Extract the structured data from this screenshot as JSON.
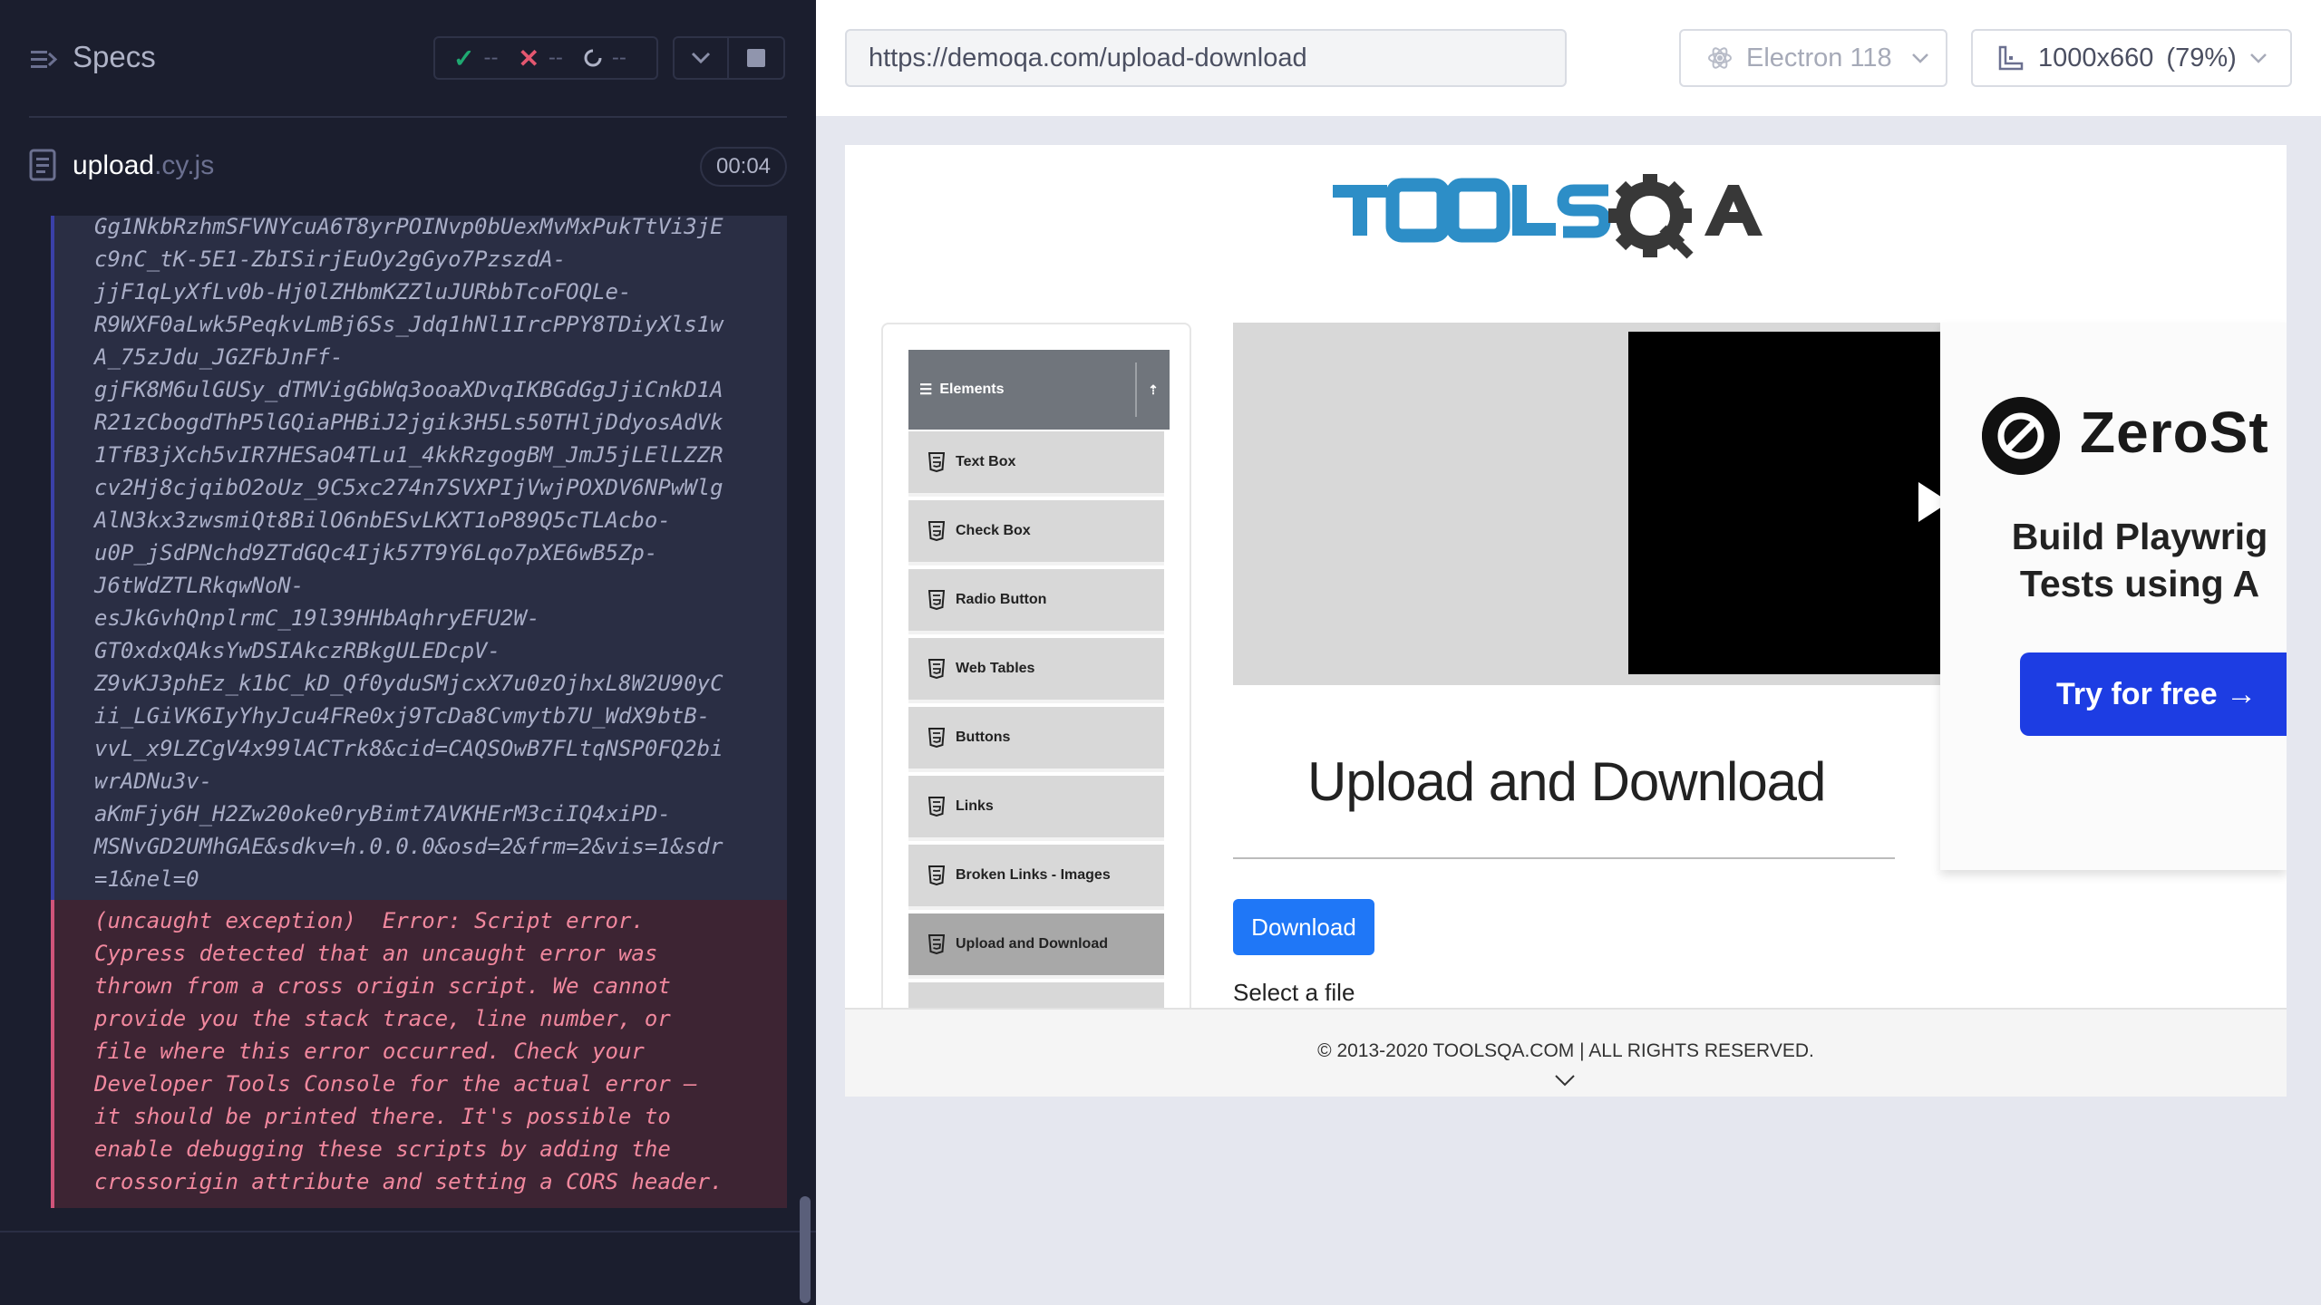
{
  "runner": {
    "title": "Specs",
    "stats": {
      "passed": "--",
      "failed": "--",
      "pending": "--"
    },
    "spec_file": {
      "name": "upload",
      "ext": ".cy.js",
      "duration": "00:04"
    },
    "log_url_text": "Gg1NkbRzhmSFVNYcuA6T8yrPOINvp0bUexMvMxPukTtVi3jE\nc9nC_tK-5E1-ZbISirjEuOy2gGyo7PzszdA-\njjF1qLyXfLv0b-Hj0lZHbmKZZluJURbbTcoFOQLe-\nR9WXF0aLwk5PeqkvLmBj6Ss_Jdq1hNl1IrcPPY8TDiyXls1w\nA_75zJdu_JGZFbJnFf-\ngjFK8M6ulGUSy_dTMVigGbWq3ooaXDvqIKBGdGgJjiCnkD1A\nR21zCbogdThP5lGQiaPHBiJ2jgik3H5Ls50THljDdyosAdVk\n1TfB3jXch5vIR7HESaO4TLu1_4kkRzgogBM_JmJ5jLElLZZR\ncv2Hj8cjqibO2oUz_9C5xc274n7SVXPIjVwjPOXDV6NPwWlg\nAlN3kx3zwsmiQt8BilO6nbESvLKXT1oP89Q5cTLAcbo-\nu0P_jSdPNchd9ZTdGQc4Ijk57T9Y6Lqo7pXE6wB5Zp-\nJ6tWdZTLRkqwNoN-\nesJkGvhQnplrmC_19l39HHbAqhryEFU2W-\nGT0xdxQAksYwDSIAkczRBkgULEDcpV-\nZ9vKJ3phEz_k1bC_kD_Qf0yduSMjcxX7u0zOjhxL8W2U90yC\nii_LGiVK6IyYhyJcu4FRe0xj9TcDa8Cvmytb7U_WdX9btB-\nvvL_x9LZCgV4x99lACTrk8&cid=CAQSOwB7FLtqNSP0FQ2bi\nwrADNu3v-\naKmFjy6H_H2Zw20oke0ryBimt7AVKHErM3ciIQ4xiPD-\nMSNvGD2UMhGAE&sdkv=h.0.0.0&osd=2&frm=2&vis=1&sdr\n=1&nel=0",
    "error_text": "(uncaught exception)  Error: Script error.\nCypress detected that an uncaught error was\nthrown from a cross origin script. We cannot\nprovide you the stack trace, line number, or\nfile where this error occurred. Check your\nDeveloper Tools Console for the actual error –\nit should be printed there. It's possible to\nenable debugging these scripts by adding the\ncrossorigin attribute and setting a CORS header."
  },
  "aut": {
    "url": "https://demoqa.com/upload-download",
    "browser": "Electron 118",
    "viewport": "1000x660",
    "viewport_scale": "(79%)"
  },
  "site": {
    "logo_alt": "TOOLSQA",
    "sidebar": {
      "group_label": "Elements",
      "items": [
        {
          "label": "Text Box"
        },
        {
          "label": "Check Box"
        },
        {
          "label": "Radio Button"
        },
        {
          "label": "Web Tables"
        },
        {
          "label": "Buttons"
        },
        {
          "label": "Links"
        },
        {
          "label": "Broken Links - Images"
        },
        {
          "label": "Upload and Download"
        }
      ]
    },
    "ad": {
      "brand": "ZeroSt",
      "headline": "Build Playwrig\nTests using A",
      "cta": "Try for free →"
    },
    "heading": "Upload and Download",
    "download_label": "Download",
    "select_label": "Select a file",
    "footer": "© 2013-2020 TOOLSQA.COM | ALL RIGHTS RESERVED."
  },
  "colors": {
    "runner_bg": "#1b1e2e",
    "pass": "#1fa971",
    "fail": "#e45770",
    "download_btn": "#1f77f7",
    "ad_cta": "#1d3de3"
  }
}
